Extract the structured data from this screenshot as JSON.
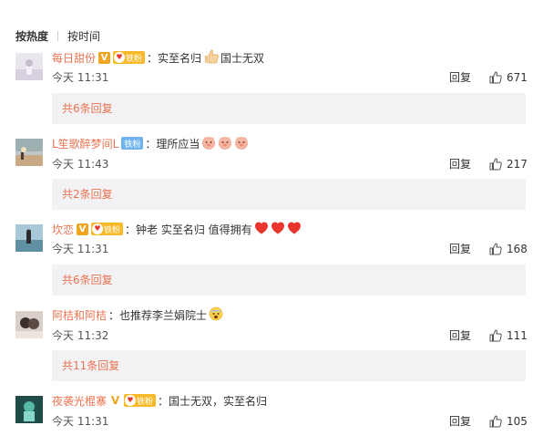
{
  "sort": {
    "hot_label": "按热度",
    "time_label": "按时间"
  },
  "fan_label": "铁粉",
  "v_label": "V",
  "reply_label": "回复",
  "comments": [
    {
      "username": "每日甜份",
      "text": "：实至名归",
      "text_after": "国士无双",
      "time": "今天 11:31",
      "likes": "671",
      "subreplies": "共6条回复"
    },
    {
      "username": "L笙歌醉梦间L",
      "text": "：理所应当",
      "time": "今天 11:43",
      "likes": "217",
      "subreplies": "共2条回复"
    },
    {
      "username": "坎恋",
      "text": "：钟老 实至名归 值得拥有",
      "time": "今天 11:31",
      "likes": "168",
      "subreplies": "共6条回复"
    },
    {
      "username": "阿桔和阿桔",
      "text": "：也推荐李兰娟院士",
      "time": "今天 11:32",
      "likes": "111",
      "subreplies": "共11条回复"
    },
    {
      "username": "夜袭光棍寨",
      "text": "：国士无双，实至名归",
      "time": "今天 11:31",
      "likes": "105"
    }
  ],
  "icons": {
    "like": "thumbs-up-icon",
    "emoji_thumb": "thumbs-up-emoji-icon",
    "emoji_pig": "pig-emoji-icon",
    "emoji_heart": "heart-emoji-icon",
    "emoji_scared": "scared-emoji-icon"
  },
  "colors": {
    "username": "#eb7350",
    "fan_badge": "#f7b928",
    "fan_badge_blue": "#6fb3ee",
    "v_badge": "#f0a61e",
    "subreply_bg": "#f2f2f5"
  }
}
